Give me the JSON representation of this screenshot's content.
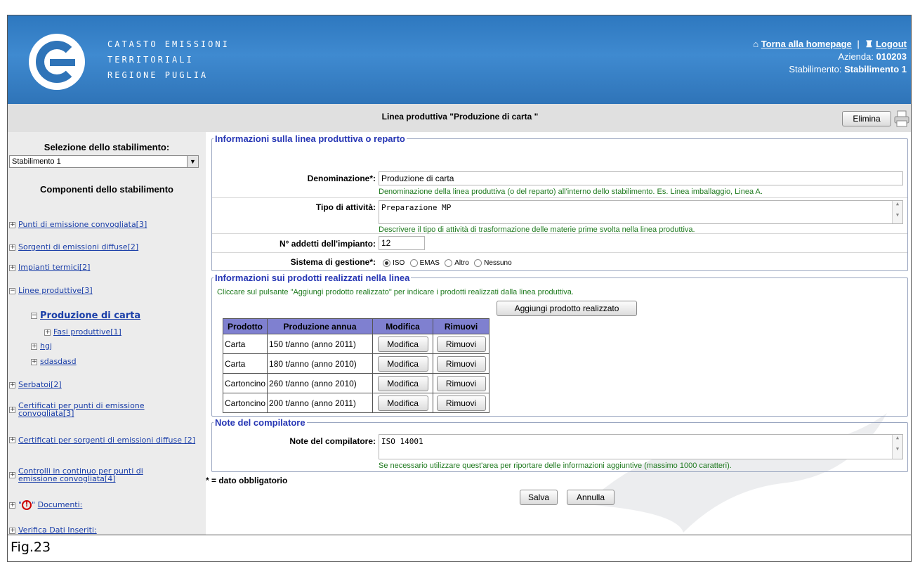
{
  "header": {
    "brand_lines": [
      "Catasto Emissioni",
      "Territoriali",
      "Regione Puglia"
    ],
    "homepage_link": "Torna alla homepage",
    "logout_link": "Logout",
    "azienda_label": "Azienda:",
    "azienda_value": "010203",
    "stabilimento_label": "Stabilimento:",
    "stabilimento_value": "Stabilimento 1",
    "brand_color": "#2f74b8"
  },
  "titlebar": {
    "title": "Linea produttiva \"Produzione di carta \"",
    "delete_button": "Elimina"
  },
  "sidebar": {
    "select_heading": "Selezione dello stabilimento:",
    "select_value": "Stabilimento 1",
    "components_heading": "Componenti dello stabilimento",
    "items": [
      {
        "label": "Punti di emissione convogliata[3]"
      },
      {
        "label": "Sorgenti di emissioni diffuse[2]"
      },
      {
        "label": "Impianti termici[2]"
      },
      {
        "label": "Linee produttive[3]"
      },
      {
        "label": "Produzione di carta"
      },
      {
        "label": "Fasi produttive[1]"
      },
      {
        "label": "hgj"
      },
      {
        "label": "sdasdasd"
      },
      {
        "label": "Serbatoi[2]"
      },
      {
        "label": "Certificati per punti di emissione convogliata[3]"
      },
      {
        "label": "Certificati per sorgenti di emissioni diffuse [2]"
      },
      {
        "label": "Controlli in continuo per punti di emissione convogliata[4]"
      },
      {
        "label": "Documenti:"
      },
      {
        "label": "Verifica Dati Inseriti:"
      }
    ]
  },
  "linea": {
    "legend": "Informazioni sulla linea produttiva o reparto",
    "denominazione_label": "Denominazione*:",
    "denominazione_value": "Produzione di carta",
    "denominazione_help": "Denominazione della linea produttiva (o del reparto) all'interno dello stabilimento. Es. Linea imballaggio, Linea A.",
    "attivita_label": "Tipo di attività:",
    "attivita_value": "Preparazione MP",
    "attivita_help": "Descrivere il tipo di attività di trasformazione delle materie prime svolta nella linea produttiva.",
    "addetti_label": "N° addetti dell'impianto:",
    "addetti_value": "12",
    "gestione_label": "Sistema di gestione*:",
    "gestione_options": [
      "ISO",
      "EMAS",
      "Altro",
      "Nessuno"
    ],
    "gestione_selected": "ISO"
  },
  "prodotti": {
    "legend": "Informazioni sui prodotti realizzati nella linea",
    "instructions": "Cliccare sul pulsante \"Aggiungi prodotto realizzato\" per indicare i prodotti realizzati dalla linea produttiva.",
    "add_button": "Aggiungi prodotto realizzato",
    "columns": [
      "Prodotto",
      "Produzione annua",
      "Modifica",
      "Rimuovi"
    ],
    "rows": [
      {
        "prodotto": "Carta",
        "produzione": "150 t/anno (anno 2011)",
        "modifica": "Modifica",
        "rimuovi": "Rimuovi"
      },
      {
        "prodotto": "Carta",
        "produzione": "180 t/anno (anno 2010)",
        "modifica": "Modifica",
        "rimuovi": "Rimuovi"
      },
      {
        "prodotto": "Cartoncino",
        "produzione": "260 t/anno (anno 2010)",
        "modifica": "Modifica",
        "rimuovi": "Rimuovi"
      },
      {
        "prodotto": "Cartoncino",
        "produzione": "200 t/anno (anno 2011)",
        "modifica": "Modifica",
        "rimuovi": "Rimuovi"
      }
    ],
    "header_color": "#7f80d0"
  },
  "note": {
    "legend": "Note del compilatore",
    "label": "Note del compilatore:",
    "value": "ISO 14001",
    "help": "Se necessario utilizzare quest'area per riportare delle informazioni aggiuntive (massimo 1000 caratteri)."
  },
  "footer": {
    "required_note": "* = dato obbligatorio",
    "save_button": "Salva",
    "cancel_button": "Annulla"
  },
  "caption": "Fig.23"
}
